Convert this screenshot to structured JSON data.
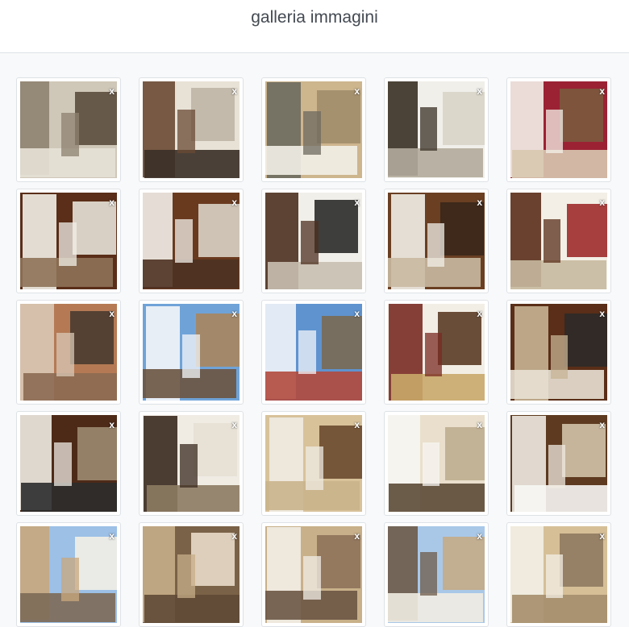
{
  "header": {
    "title": "galleria immagini"
  },
  "gallery": {
    "remove_label": "x",
    "images": [
      {
        "colors": [
          "#cfc7b8",
          "#8e8270",
          "#5b4c3d",
          "#e6e1d6"
        ]
      },
      {
        "colors": [
          "#e8e2d6",
          "#6a4a34",
          "#bfb6a6",
          "#3a2f27"
        ]
      },
      {
        "colors": [
          "#cdb58e",
          "#6d6a5f",
          "#a28d6b",
          "#f3efe7"
        ]
      },
      {
        "colors": [
          "#f0efea",
          "#3a3025",
          "#d8d4c8",
          "#b3ab9c"
        ]
      },
      {
        "colors": [
          "#9b2233",
          "#f4f1ea",
          "#7b5a3e",
          "#d8c8b0"
        ]
      },
      {
        "colors": [
          "#5a2e18",
          "#f2efe8",
          "#e6e2d7",
          "#8d7258"
        ]
      },
      {
        "colors": [
          "#6a3a1f",
          "#f3f0e9",
          "#d9d3c5",
          "#4e3222"
        ]
      },
      {
        "colors": [
          "#f1efe9",
          "#4d3020",
          "#2a2a2a",
          "#c8bfb0"
        ]
      },
      {
        "colors": [
          "#6a3f22",
          "#f2efe8",
          "#3a271b",
          "#c9b9a2"
        ]
      },
      {
        "colors": [
          "#f3efe6",
          "#5a2e1a",
          "#9e2b2b",
          "#c8b9a0"
        ]
      },
      {
        "colors": [
          "#b57a54",
          "#d9c8b5",
          "#4a3b30",
          "#8c6a52"
        ]
      },
      {
        "colors": [
          "#6fa3d8",
          "#f4f6fa",
          "#a8865e",
          "#6b5441"
        ]
      },
      {
        "colors": [
          "#5f93cf",
          "#f1f4f8",
          "#7a6a52",
          "#b24a3d"
        ]
      },
      {
        "colors": [
          "#f2eee6",
          "#7a2b23",
          "#5b3b25",
          "#c9a86a"
        ]
      },
      {
        "colors": [
          "#5a2e18",
          "#c7b494",
          "#2e2a28",
          "#e8e1d4"
        ]
      },
      {
        "colors": [
          "#4d2a18",
          "#efebe3",
          "#9c8a70",
          "#2c2c2c"
        ]
      },
      {
        "colors": [
          "#f0ece4",
          "#3a2a1f",
          "#e6e0d4",
          "#8d7b62"
        ]
      },
      {
        "colors": [
          "#d8c29a",
          "#efebe3",
          "#6b4a2d",
          "#c9b48c"
        ]
      },
      {
        "colors": [
          "#e9dfcc",
          "#f7f6f3",
          "#bfae90",
          "#5c4a36"
        ]
      },
      {
        "colors": [
          "#5e3a20",
          "#f0ebe2",
          "#d2c3a9",
          "#f7f6f3"
        ]
      },
      {
        "colors": [
          "#9cc0e6",
          "#c9a77c",
          "#f3efe6",
          "#7d6a56"
        ]
      },
      {
        "colors": [
          "#7a6248",
          "#c7ae88",
          "#e8dcc8",
          "#5f4a36"
        ]
      },
      {
        "colors": [
          "#c8b08a",
          "#f2eee6",
          "#8e735a",
          "#6c5744"
        ]
      },
      {
        "colors": [
          "#a9c8e8",
          "#6d5a48",
          "#c4ab86",
          "#f1ece2"
        ]
      },
      {
        "colors": [
          "#d6bf97",
          "#f3efe6",
          "#8f7a60",
          "#a58e6b"
        ]
      }
    ]
  }
}
